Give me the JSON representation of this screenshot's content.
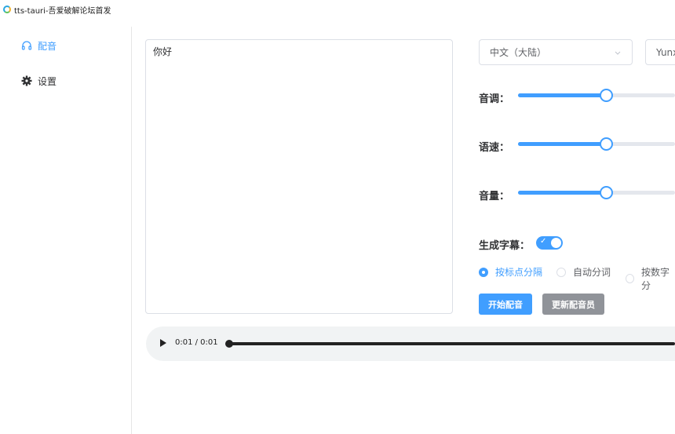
{
  "window": {
    "title": "tts-tauri-吾爱破解论坛首发"
  },
  "sidebar": {
    "items": [
      {
        "label": "配音",
        "icon": "headphones-icon",
        "active": true
      },
      {
        "label": "设置",
        "icon": "gear-icon",
        "active": false
      }
    ]
  },
  "editor": {
    "text": "你好"
  },
  "voice": {
    "language": "中文（大陆）",
    "voice_name": "Yunx"
  },
  "controls": {
    "pitch": {
      "label": "音调：",
      "value_percent": 55
    },
    "rate": {
      "label": "语速：",
      "value_percent": 55
    },
    "volume": {
      "label": "音量：",
      "value_percent": 55
    },
    "subtitle": {
      "label": "生成字幕：",
      "enabled": true
    },
    "split_options": [
      {
        "label": "按标点分隔",
        "checked": true
      },
      {
        "label": "自动分词",
        "checked": false
      },
      {
        "label": "按数字分",
        "checked": false
      }
    ]
  },
  "buttons": {
    "start": "开始配音",
    "update_voices": "更新配音员"
  },
  "player": {
    "time": "0:01 / 0:01",
    "progress_percent": 100
  },
  "colors": {
    "accent": "#409eff",
    "info": "#909399"
  }
}
